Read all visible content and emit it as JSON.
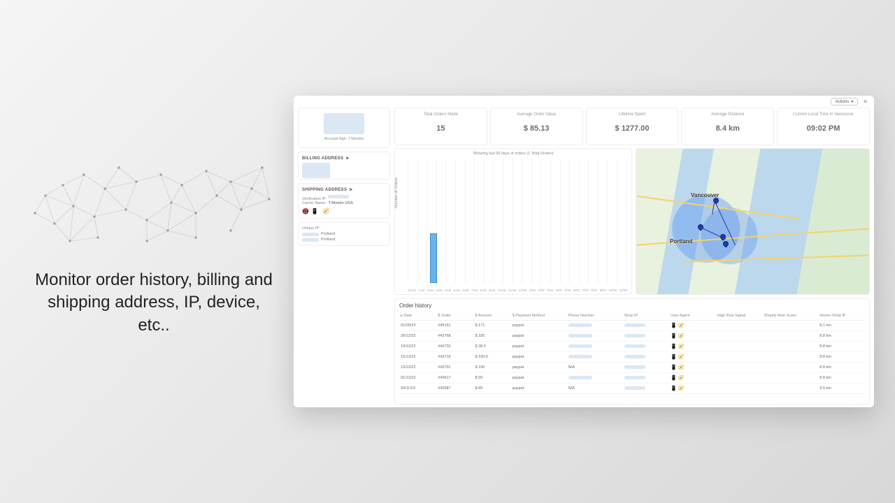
{
  "marketing_caption": "Monitor order history, billing and shipping address, IP, device, etc..",
  "topbar": {
    "actions_label": "Actions"
  },
  "profile": {
    "account_age_label": "Account Age: 7 Months"
  },
  "sections": {
    "billing_title": "BILLING ADDRESS",
    "shipping_title": "SHIPPING ADDRESS",
    "verification_label": "Verification IP:",
    "carrier_label": "Carrier Name :",
    "carrier_value": "T-Mobile USA",
    "unique_ip_title": "Unique IP:",
    "unique_ip_cities": [
      "Portland",
      "Portland"
    ]
  },
  "kpis": [
    {
      "label": "Total Orders Made",
      "value": "15"
    },
    {
      "label": "Average Order Value",
      "value": "$ 85.13"
    },
    {
      "label": "Lifetime Spent",
      "value": "$ 1277.00"
    },
    {
      "label": "Average Distance",
      "value": "8.4 km"
    },
    {
      "label": "Current Local Time in Vancouver",
      "value": "09:02 PM"
    }
  ],
  "chart_data": {
    "type": "bar",
    "title": "Showing last 90 days of orders (1 Total Orders)",
    "ylabel": "Number of Orders",
    "categories": [
      "12AM",
      "1AM",
      "2AM",
      "3AM",
      "4AM",
      "5AM",
      "6AM",
      "7AM",
      "8AM",
      "9AM",
      "10AM",
      "11AM",
      "12PM",
      "1PM",
      "2PM",
      "3PM",
      "4PM",
      "5PM",
      "6PM",
      "7PM",
      "8PM",
      "9PM",
      "10PM",
      "11PM"
    ],
    "values": [
      0,
      0,
      1,
      0,
      0,
      0,
      0,
      0,
      0,
      0,
      0,
      0,
      0,
      0,
      0,
      0,
      0,
      0,
      0,
      0,
      0,
      0,
      0,
      0
    ],
    "ylim": [
      0,
      2
    ]
  },
  "map": {
    "city_labels": [
      "Vancouver",
      "Portland"
    ]
  },
  "order_history": {
    "title": "Order history",
    "columns": [
      "Date",
      "Order",
      "Amount",
      "Payment Method",
      "Phone Number",
      "Shop IP",
      "User Agent",
      "High Risk Signal",
      "Shopify Risk Score",
      "Home–Shop IP"
    ],
    "rows": [
      {
        "date": "01/05/23",
        "order": "#45151",
        "amount": "$ 171",
        "payment": "paypal",
        "phone_redacted": true,
        "ip_redacted": true,
        "home_shop_ip": "8.1 km"
      },
      {
        "date": "20/12/22",
        "order": "#43768",
        "amount": "$ 180",
        "payment": "paypal",
        "phone_redacted": true,
        "ip_redacted": true,
        "home_shop_ip": "8.8 km"
      },
      {
        "date": "19/12/22",
        "order": "#43732",
        "amount": "$ 28.5",
        "payment": "paypal",
        "phone_redacted": true,
        "ip_redacted": true,
        "home_shop_ip": "8.8 km"
      },
      {
        "date": "15/12/22",
        "order": "#43716",
        "amount": "$ 100.5",
        "payment": "paypal",
        "phone_redacted": true,
        "ip_redacted": true,
        "home_shop_ip": "8.8 km"
      },
      {
        "date": "13/12/22",
        "order": "#43701",
        "amount": "$ 100",
        "payment": "paypal",
        "phone_text": "N/A",
        "ip_redacted": true,
        "home_shop_ip": "8.8 km"
      },
      {
        "date": "01/12/22",
        "order": "#43617",
        "amount": "$ 50",
        "payment": "paypal",
        "phone_redacted": true,
        "ip_redacted": true,
        "home_shop_ip": "8.8 km"
      },
      {
        "date": "30/11/22",
        "order": "#43587",
        "amount": "$ 89",
        "payment": "paypal",
        "phone_text": "N/A",
        "ip_redacted": true,
        "home_shop_ip": "9.5 km"
      }
    ]
  }
}
